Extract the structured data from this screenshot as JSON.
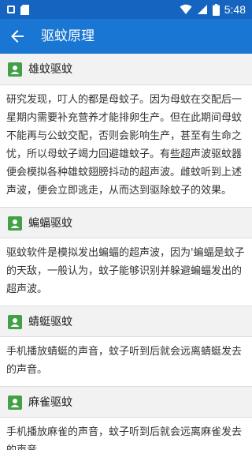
{
  "status_bar": {
    "time": "5:48"
  },
  "app_bar": {
    "title": "驱蚊原理",
    "back_icon": "arrow-back-icon"
  },
  "sections": [
    {
      "title": "雄蚊驱蚊",
      "icon": "contact-card-icon",
      "body": "研究发现，叮人的都是母蚊子。因为母蚊在交配后一星期内需要补充营养才能排卵生产。但在此期间母蚊不能再与公蚊交配，否则会影响生产，甚至有生命之忧，所以母蚊子竭力回避雄蚊子。有些超声波驱蚊器便会模拟各种雄蚊翅膀抖动的超声波。雌蚊听到上述声波，便会立即逃走，从而达到驱除蚊子的效果。"
    },
    {
      "title": "蝙蝠驱蚊",
      "icon": "contact-card-icon",
      "body": "驱蚊软件是模拟发出蝙蝠的超声波，因为'蝙蝠是蚊子的天敌，一般认为，蚊子能够识别并躲避蝙蝠发出的超声波。"
    },
    {
      "title": "蜻蜓驱蚊",
      "icon": "contact-card-icon",
      "body": "手机播放蜻蜓的声音，蚊子听到后就会远离蜻蜓发去的声音。"
    },
    {
      "title": "麻雀驱蚊",
      "icon": "contact-card-icon",
      "body": "手机播放麻雀的声音，蚊子听到后就会远离麻雀发去的声音。"
    }
  ],
  "colors": {
    "status_bar": "#1565c0",
    "app_bar": "#1976d2",
    "icon_green": "#43a047",
    "section_header_bg": "#f2f2f2"
  }
}
